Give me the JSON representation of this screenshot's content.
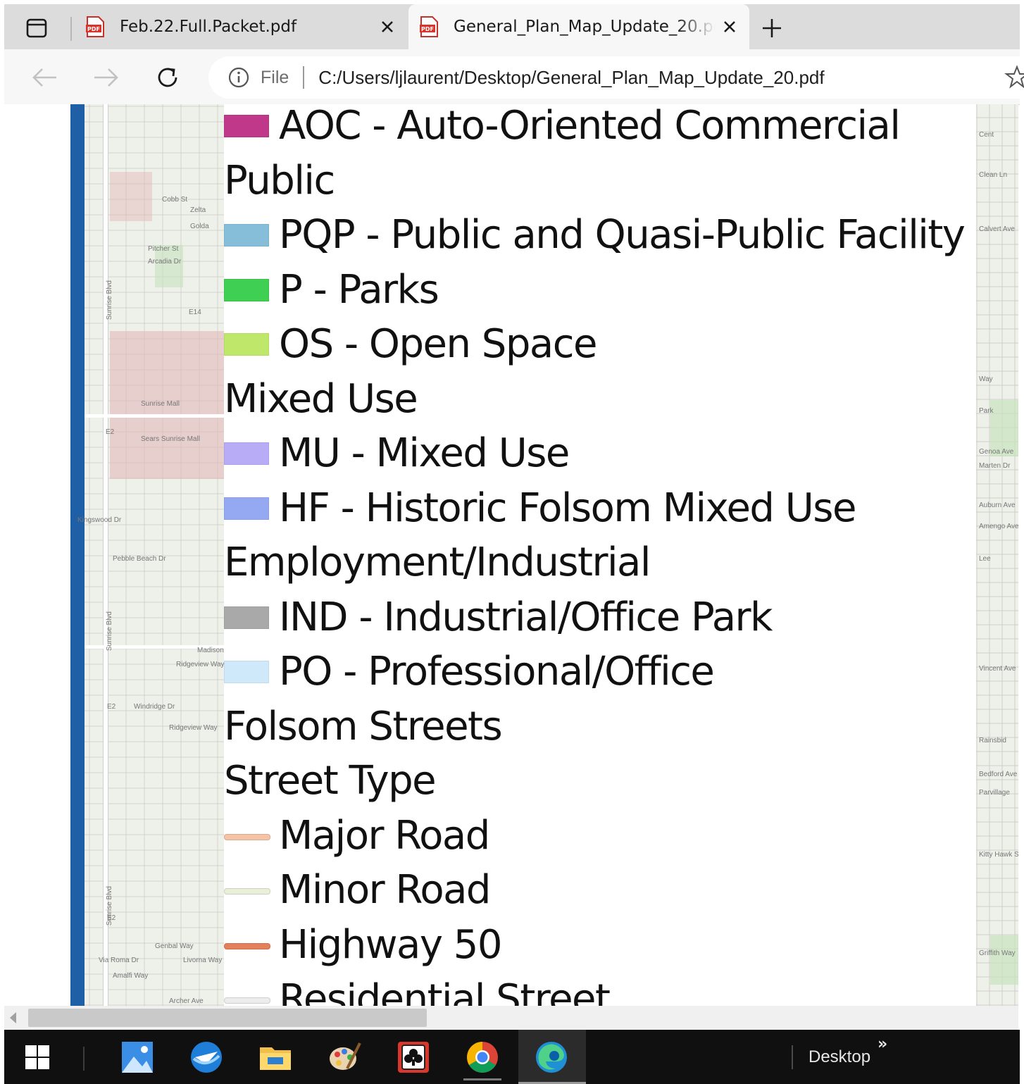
{
  "browser": {
    "tabs": [
      {
        "title": "Feb.22.Full.Packet.pdf",
        "active": false,
        "icon": "pdf-icon"
      },
      {
        "title": "General_Plan_Map_Update_20.pdf",
        "active": true,
        "icon": "pdf-icon"
      }
    ],
    "address": {
      "scheme_label": "File",
      "url": "C:/Users/ljlaurent/Desktop/General_Plan_Map_Update_20.pdf"
    }
  },
  "legend": {
    "rows": [
      {
        "kind": "item",
        "swatch_type": "box",
        "color": "#c0388a",
        "label": "AOC - Auto-Oriented Commercial"
      },
      {
        "kind": "heading",
        "label": "Public"
      },
      {
        "kind": "item",
        "swatch_type": "box",
        "color": "#86bdd8",
        "label": "PQP - Public and Quasi-Public Facility"
      },
      {
        "kind": "item",
        "swatch_type": "box",
        "color": "#3ecf53",
        "label": "P - Parks"
      },
      {
        "kind": "item",
        "swatch_type": "box",
        "color": "#bfe86a",
        "label": "OS - Open Space"
      },
      {
        "kind": "heading",
        "label": "Mixed Use"
      },
      {
        "kind": "item",
        "swatch_type": "box",
        "color": "#b7acf5",
        "label": "MU - Mixed Use"
      },
      {
        "kind": "item",
        "swatch_type": "box",
        "color": "#94a9f2",
        "label": "HF - Historic Folsom Mixed Use"
      },
      {
        "kind": "heading",
        "label": "Employment/Industrial"
      },
      {
        "kind": "item",
        "swatch_type": "box",
        "color": "#a9a9a9",
        "label": "IND - Industrial/Office Park"
      },
      {
        "kind": "item",
        "swatch_type": "box",
        "color": "#cfe9fb",
        "label": "PO - Professional/Office"
      },
      {
        "kind": "heading",
        "label": "Folsom Streets"
      },
      {
        "kind": "heading",
        "label": "Street Type"
      },
      {
        "kind": "item",
        "swatch_type": "line",
        "color": "#f5c3a6",
        "label": "Major Road"
      },
      {
        "kind": "item",
        "swatch_type": "line",
        "color": "#e9efd8",
        "label": "Minor Road"
      },
      {
        "kind": "item",
        "swatch_type": "line",
        "color": "#e4815a",
        "label": "Highway 50"
      },
      {
        "kind": "item",
        "swatch_type": "line",
        "color": "#ececec",
        "label": "Residential Street"
      }
    ]
  },
  "map_labels_left": [
    "Cobb St",
    "Zelta",
    "Golda",
    "Pitcher St",
    "Arcadia Dr",
    "E14",
    "Sunrise Blvd",
    "Sunrise Mall",
    "Sears Sunrise Mall",
    "E2",
    "Kingswood Dr",
    "Pebble Beach Dr",
    "Sunrise Blvd",
    "Madison",
    "Ridgeview Way",
    "Windridge Dr",
    "Ridgeview Way",
    "Sunrise Blvd",
    "Genbal Way",
    "Via Roma Dr",
    "Livorna Way",
    "Amalfi Way",
    "Archer Ave",
    "E2",
    "E2"
  ],
  "map_labels_right": [
    "Cent",
    "Clean Ln",
    "Calvert Ave",
    "Way",
    "Park",
    "Genoa Ave",
    "Marten Dr",
    "Auburn Ave",
    "Amengo Ave",
    "Lee",
    "Vincent Ave",
    "Rainsbid",
    "Bedford Ave",
    "Parvillage",
    "Kitty Hawk St",
    "Griffith Way"
  ],
  "taskbar": {
    "apps": [
      "windows-start",
      "photos",
      "thunderbird",
      "file-explorer",
      "paint",
      "solitaire",
      "chrome",
      "edge"
    ],
    "desktop_label": "Desktop",
    "overflow_label": "»"
  }
}
